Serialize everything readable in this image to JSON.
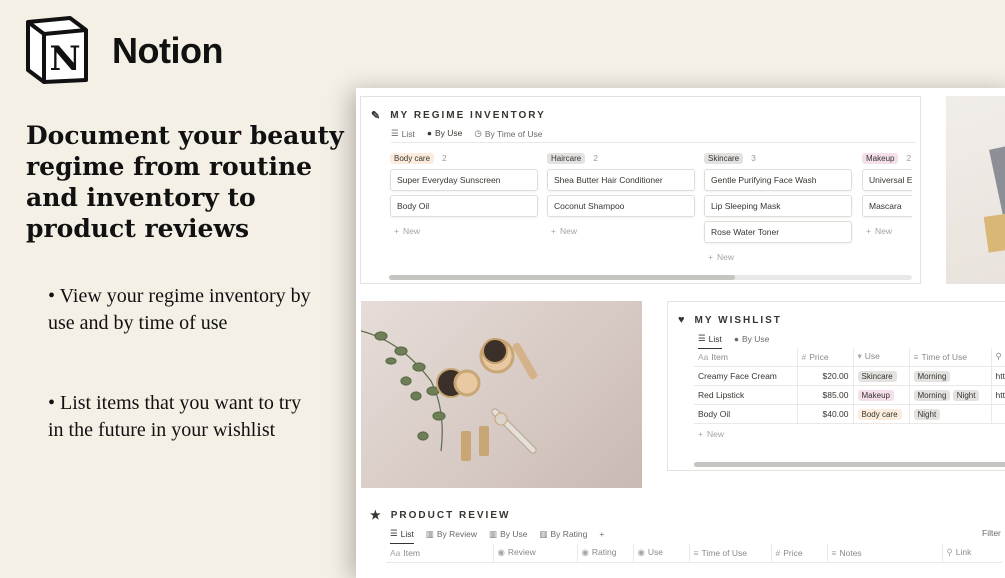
{
  "brand": {
    "name": "Notion",
    "logo_letter": "N"
  },
  "headline": "Document your beauty regime from routine and inventory to product reviews",
  "bullets": [
    "• View your regime inventory by use and by time of use",
    "• List items that you want to try in the future in your wishlist"
  ],
  "inventory": {
    "title": "MY REGIME INVENTORY",
    "tabs": [
      {
        "label": "List",
        "icon": "list-icon"
      },
      {
        "label": "By Use",
        "icon": "person-icon"
      },
      {
        "label": "By Time of Use",
        "icon": "clock-icon"
      }
    ],
    "new_label": "New",
    "columns": [
      {
        "tag": "Body care",
        "tag_color": "#fbecdd",
        "count": "2",
        "items": [
          "Super Everyday Sunscreen",
          "Body Oil"
        ]
      },
      {
        "tag": "Haircare",
        "tag_color": "#e3e2e0",
        "count": "2",
        "items": [
          "Shea Butter Hair Conditioner",
          "Coconut Shampoo"
        ]
      },
      {
        "tag": "Skincare",
        "tag_color": "#e3e2e0",
        "count": "3",
        "items": [
          "Gentle Purifying Face Wash",
          "Lip Sleeping Mask",
          "Rose Water Toner"
        ]
      },
      {
        "tag": "Makeup",
        "tag_color": "#f4dfeb",
        "count": "2",
        "items": [
          "Universal Ey",
          "Mascara"
        ]
      }
    ]
  },
  "wishlist": {
    "title": "MY WISHLIST",
    "tabs": [
      {
        "label": "List",
        "icon": "list-icon"
      },
      {
        "label": "By Use",
        "icon": "person-icon"
      }
    ],
    "headers": [
      "Item",
      "Price",
      "Use",
      "Time of Use",
      "htt"
    ],
    "rows": [
      {
        "item": "Creamy Face Cream",
        "price": "$20.00",
        "use": "Skincare",
        "use_color": "#e3e2e0",
        "times": [
          "Morning"
        ],
        "link": "htt"
      },
      {
        "item": "Red Lipstick",
        "price": "$85.00",
        "use": "Makeup",
        "use_color": "#f4dfeb",
        "times": [
          "Morning",
          "Night"
        ],
        "link": "htt"
      },
      {
        "item": "Body Oil",
        "price": "$40.00",
        "use": "Body care",
        "use_color": "#fbecdd",
        "times": [
          "Night"
        ],
        "link": "htt"
      }
    ],
    "new_label": "New"
  },
  "review": {
    "title": "PRODUCT REVIEW",
    "tabs": [
      {
        "label": "List",
        "icon": "list-icon"
      },
      {
        "label": "By Review",
        "icon": "board-icon"
      },
      {
        "label": "By Use",
        "icon": "board-icon"
      },
      {
        "label": "By Rating",
        "icon": "board-icon"
      }
    ],
    "filter_label": "Filter",
    "headers": [
      "Item",
      "Review",
      "Rating",
      "Use",
      "Time of Use",
      "Price",
      "Notes",
      "Link"
    ]
  }
}
